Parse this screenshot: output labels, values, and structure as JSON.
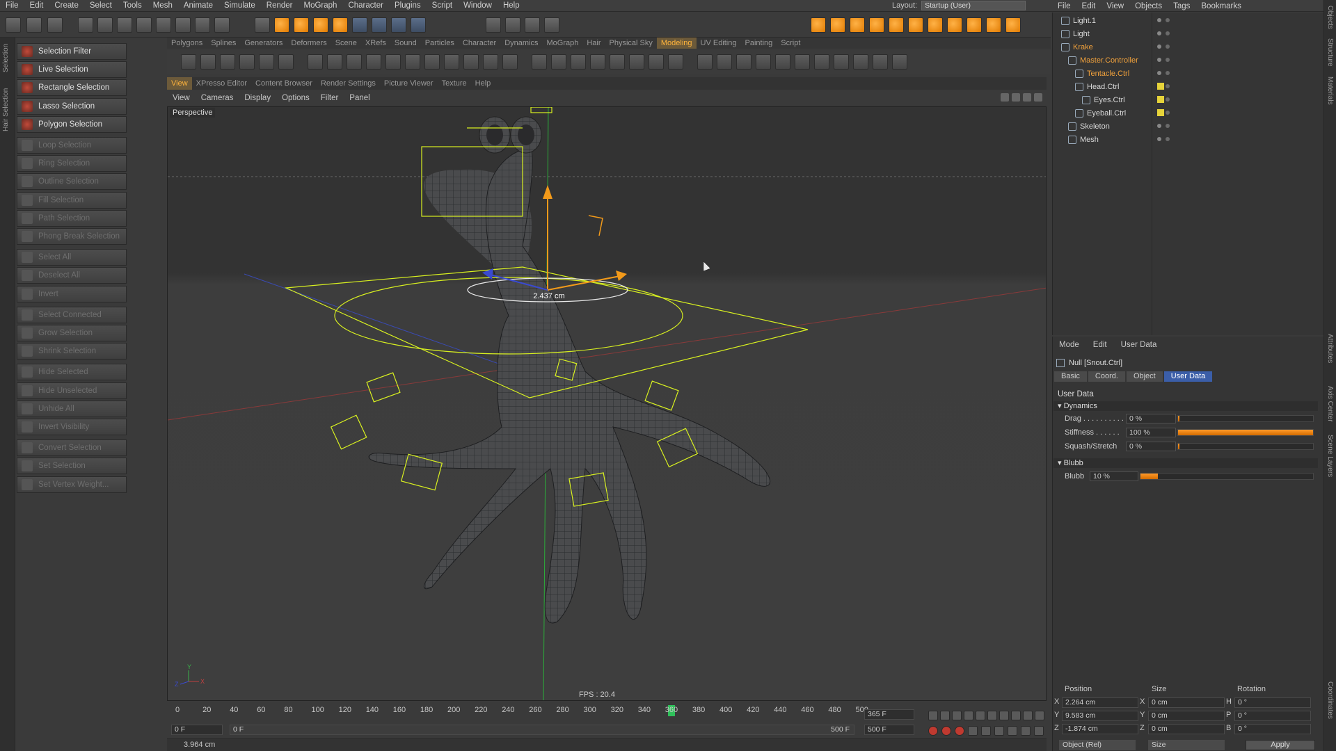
{
  "menubar": {
    "items": [
      "File",
      "Edit",
      "Create",
      "Select",
      "Tools",
      "Mesh",
      "Animate",
      "Simulate",
      "Render",
      "MoGraph",
      "Character",
      "Plugins",
      "Script",
      "Window",
      "Help"
    ]
  },
  "layout": {
    "label": "Layout:",
    "value": "Startup (User)"
  },
  "object_menu": {
    "items": [
      "File",
      "Edit",
      "View",
      "Objects",
      "Tags",
      "Bookmarks"
    ]
  },
  "tabs": {
    "items": [
      "Polygons",
      "Splines",
      "Generators",
      "Deformers",
      "Scene",
      "XRefs",
      "Sound",
      "Particles",
      "Character",
      "Dynamics",
      "MoGraph",
      "Hair",
      "Physical Sky",
      "Modeling",
      "UV Editing",
      "Painting",
      "Script"
    ],
    "active_index": 13
  },
  "left_strip": {
    "labels": [
      "Selection",
      "Hair Selection"
    ]
  },
  "selection_panel": {
    "items": [
      {
        "label": "Selection Filter",
        "enabled": true
      },
      {
        "label": "Live Selection",
        "enabled": true
      },
      {
        "label": "Rectangle Selection",
        "enabled": true
      },
      {
        "label": "Lasso Selection",
        "enabled": true
      },
      {
        "label": "Polygon Selection",
        "enabled": true
      },
      {
        "label": "Loop Selection",
        "enabled": false
      },
      {
        "label": "Ring Selection",
        "enabled": false
      },
      {
        "label": "Outline Selection",
        "enabled": false
      },
      {
        "label": "Fill Selection",
        "enabled": false
      },
      {
        "label": "Path Selection",
        "enabled": false
      },
      {
        "label": "Phong Break Selection",
        "enabled": false
      },
      {
        "label": "Select All",
        "enabled": false
      },
      {
        "label": "Deselect All",
        "enabled": false
      },
      {
        "label": "Invert",
        "enabled": false
      },
      {
        "label": "Select Connected",
        "enabled": false
      },
      {
        "label": "Grow Selection",
        "enabled": false
      },
      {
        "label": "Shrink Selection",
        "enabled": false
      },
      {
        "label": "Hide Selected",
        "enabled": false
      },
      {
        "label": "Hide Unselected",
        "enabled": false
      },
      {
        "label": "Unhide All",
        "enabled": false
      },
      {
        "label": "Invert Visibility",
        "enabled": false
      },
      {
        "label": "Convert Selection",
        "enabled": false
      },
      {
        "label": "Set Selection",
        "enabled": false
      },
      {
        "label": "Set Vertex Weight...",
        "enabled": false
      }
    ]
  },
  "viewport_tabs": {
    "items": [
      "View",
      "XPresso Editor",
      "Content Browser",
      "Render Settings",
      "Picture Viewer",
      "Texture",
      "Help"
    ],
    "active_index": 0
  },
  "viewport_menu": {
    "items": [
      "View",
      "Cameras",
      "Display",
      "Options",
      "Filter",
      "Panel"
    ]
  },
  "viewport": {
    "camera_label": "Perspective",
    "measure": "2.437 cm",
    "fps": "FPS : 20.4",
    "axis_y": "Y",
    "axis_x": "X",
    "axis_z": "Z"
  },
  "timeline": {
    "ticks": [
      "0",
      "20",
      "40",
      "60",
      "80",
      "100",
      "120",
      "140",
      "160",
      "180",
      "200",
      "220",
      "240",
      "260",
      "280",
      "300",
      "320",
      "340",
      "360",
      "380",
      "400",
      "420",
      "440",
      "460",
      "480",
      "500"
    ],
    "end_frame": "365 F",
    "current_frame": "0 F",
    "range_start": "0 F",
    "range_end": "500 F",
    "max_frame": "500 F"
  },
  "status": {
    "text": "3.964 cm"
  },
  "objects": [
    {
      "name": "Light.1",
      "color": "#d8d8d8",
      "indent": 0,
      "tag": false
    },
    {
      "name": "Light",
      "color": "#d8d8d8",
      "indent": 0,
      "tag": false
    },
    {
      "name": "Krake",
      "color": "#f2a23c",
      "indent": 0,
      "tag": false
    },
    {
      "name": "Master.Controller",
      "color": "#f2a23c",
      "indent": 1,
      "tag": false
    },
    {
      "name": "Tentacle.Ctrl",
      "color": "#f2a23c",
      "indent": 2,
      "tag": false
    },
    {
      "name": "Head.Ctrl",
      "color": "#d8d8d8",
      "indent": 2,
      "tag": true
    },
    {
      "name": "Eyes.Ctrl",
      "color": "#d8d8d8",
      "indent": 3,
      "tag": true
    },
    {
      "name": "Eyeball.Ctrl",
      "color": "#d8d8d8",
      "indent": 2,
      "tag": true
    },
    {
      "name": "Skeleton",
      "color": "#d8d8d8",
      "indent": 1,
      "tag": false
    },
    {
      "name": "Mesh",
      "color": "#d8d8d8",
      "indent": 1,
      "tag": false
    }
  ],
  "attributes": {
    "menu": [
      "Mode",
      "Edit",
      "User Data"
    ],
    "title": "Null [Snout.Ctrl]",
    "tabs": [
      "Basic",
      "Coord.",
      "Object",
      "User Data"
    ],
    "active_tab": 3,
    "section": "User Data",
    "group_dynamics": "Dynamics",
    "drag_label": "Drag . . . . . . . . . .",
    "drag_value": "0 %",
    "drag_fraction": 0,
    "stiffness_label": "Stiffness . . . . . .",
    "stiffness_value": "100 %",
    "stiffness_fraction": 1.0,
    "squash_label": "Squash/Stretch",
    "squash_value": "0 %",
    "squash_fraction": 0,
    "group_blubb": "Blubb",
    "blubb_label": "Blubb",
    "blubb_value": "10 %",
    "blubb_fraction": 0.1
  },
  "coordinates": {
    "headers": [
      "Position",
      "Size",
      "Rotation"
    ],
    "rows": [
      {
        "axis": "X",
        "pos": "2.264 cm",
        "size_axis": "X",
        "size": "0 cm",
        "rot_axis": "H",
        "rot": "0 °"
      },
      {
        "axis": "Y",
        "pos": "9.583 cm",
        "size_axis": "Y",
        "size": "0 cm",
        "rot_axis": "P",
        "rot": "0 °"
      },
      {
        "axis": "Z",
        "pos": "-1.874 cm",
        "size_axis": "Z",
        "size": "0 cm",
        "rot_axis": "B",
        "rot": "0 °"
      }
    ],
    "mode": "Object (Rel)",
    "size_mode": "Size",
    "apply": "Apply"
  },
  "right_strip": {
    "labels": [
      "Objects",
      "Structure",
      "Materials",
      "Attributes",
      "Axis Center",
      "Scene Layers",
      "Coordinates"
    ]
  },
  "colors": {
    "accent": "#ffb43c",
    "selection_yellow": "#d8f020",
    "tab_active": "#3b5ea8"
  }
}
